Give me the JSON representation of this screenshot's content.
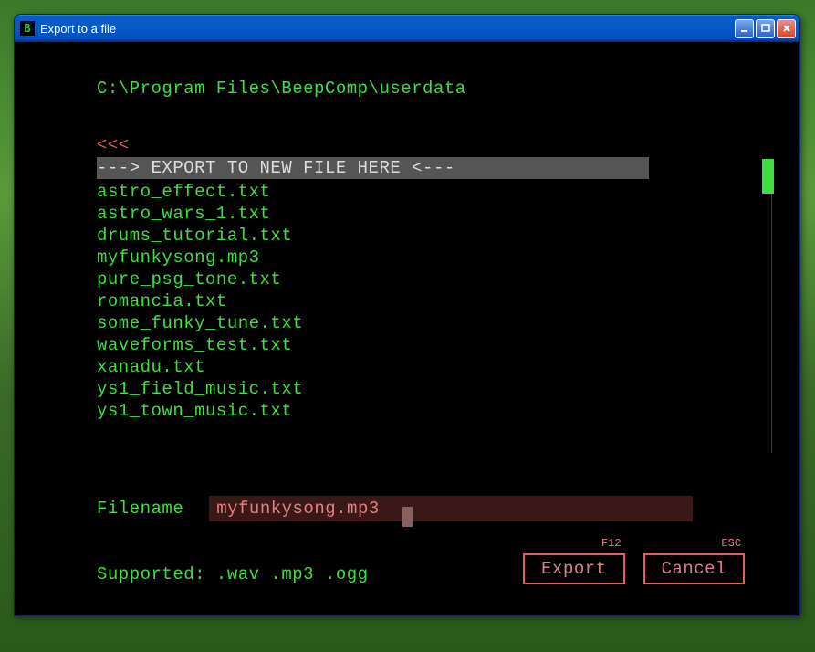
{
  "window": {
    "icon_letter": "B",
    "title": "Export to a file"
  },
  "path": "C:\\Program Files\\BeepComp\\userdata",
  "list": {
    "back": "<<<",
    "export_new": "---> EXPORT TO NEW FILE HERE <---",
    "files": [
      "astro_effect.txt",
      "astro_wars_1.txt",
      "drums_tutorial.txt",
      "myfunkysong.mp3",
      "pure_psg_tone.txt",
      "romancia.txt",
      "some_funky_tune.txt",
      "waveforms_test.txt",
      "xanadu.txt",
      "ys1_field_music.txt",
      "ys1_town_music.txt"
    ]
  },
  "filename": {
    "label": "Filename",
    "value": "myfunkysong.mp3"
  },
  "supported": "Supported: .wav .mp3 .ogg",
  "buttons": {
    "export": {
      "label": "Export",
      "hint": "F12"
    },
    "cancel": {
      "label": "Cancel",
      "hint": "ESC"
    }
  }
}
